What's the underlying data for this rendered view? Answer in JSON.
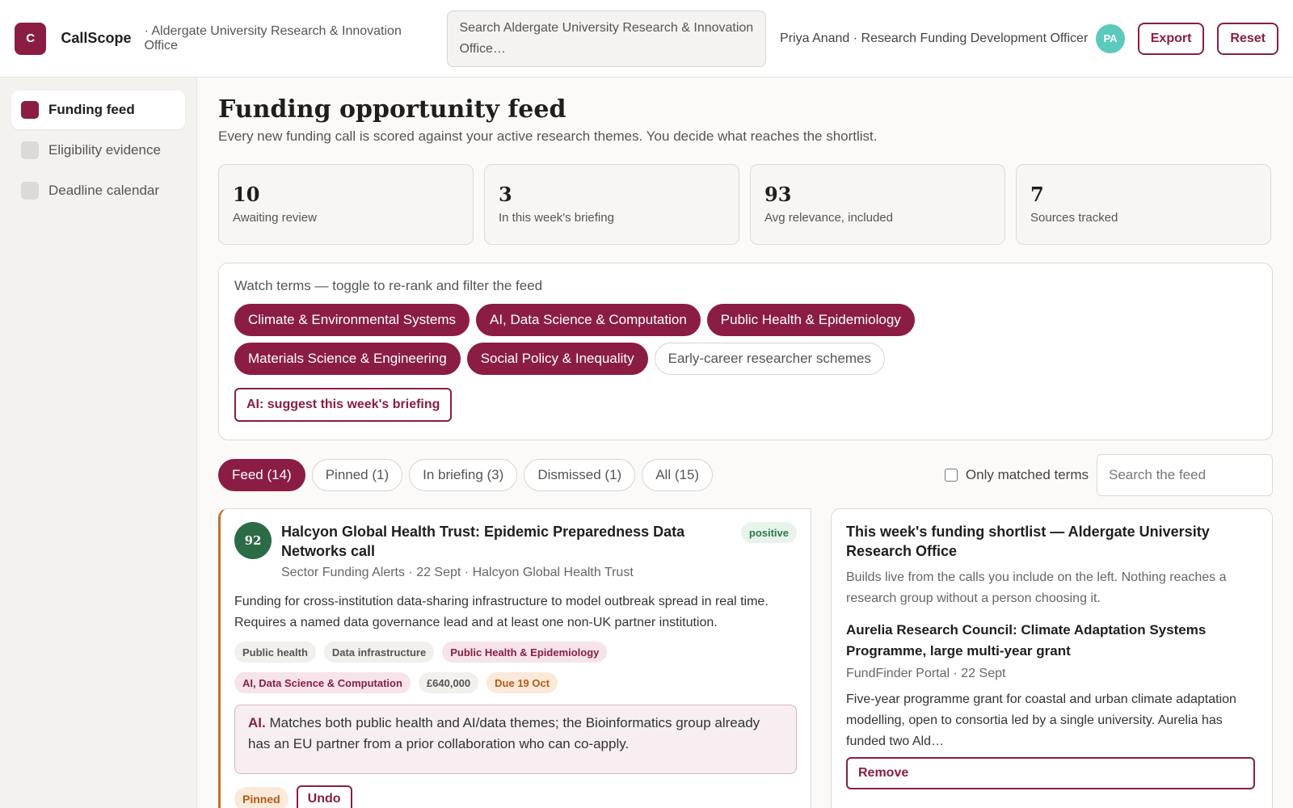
{
  "header": {
    "logo_letter": "C",
    "app_name": "CallScope",
    "org": "· Aldergate University Research & Innovation Office",
    "search_placeholder": "Search Aldergate University Research & Innovation Office…",
    "user": "Priya Anand · Research Funding Development Officer",
    "avatar_initials": "PA",
    "export_label": "Export",
    "reset_label": "Reset"
  },
  "sidebar": {
    "items": [
      {
        "label": "Funding feed",
        "active": true
      },
      {
        "label": "Eligibility evidence",
        "active": false
      },
      {
        "label": "Deadline calendar",
        "active": false
      }
    ]
  },
  "main": {
    "title": "Funding opportunity feed",
    "subtitle": "Every new funding call is scored against your active research themes. You decide what reaches the shortlist.",
    "stats": [
      {
        "value": "10",
        "label": "Awaiting review"
      },
      {
        "value": "3",
        "label": "In this week's briefing"
      },
      {
        "value": "93",
        "label": "Avg relevance, included"
      },
      {
        "value": "7",
        "label": "Sources tracked"
      }
    ],
    "watch": {
      "label": "Watch terms — toggle to re-rank and filter the feed",
      "chips": [
        {
          "label": "Climate & Environmental Systems",
          "on": true
        },
        {
          "label": "AI, Data Science & Computation",
          "on": true
        },
        {
          "label": "Public Health & Epidemiology",
          "on": true
        },
        {
          "label": "Materials Science & Engineering",
          "on": true
        },
        {
          "label": "Social Policy & Inequality",
          "on": true
        },
        {
          "label": "Early-career researcher schemes",
          "on": false
        }
      ],
      "ai_button": "AI: suggest this week's briefing"
    },
    "tabs": [
      {
        "label": "Feed (14)",
        "active": true
      },
      {
        "label": "Pinned (1)",
        "active": false
      },
      {
        "label": "In briefing (3)",
        "active": false
      },
      {
        "label": "Dismissed (1)",
        "active": false
      },
      {
        "label": "All (15)",
        "active": false
      }
    ],
    "only_matched_label": "Only matched terms",
    "search_feed_placeholder": "Search the feed"
  },
  "card": {
    "score": "92",
    "title": "Halcyon Global Health Trust: Epidemic Preparedness Data Networks call",
    "meta": "Sector Funding Alerts · 22 Sept · Halcyon Global Health Trust",
    "sentiment": "positive",
    "description": "Funding for cross-institution data-sharing infrastructure to model outbreak spread in real time. Requires a named data governance lead and at least one non-UK partner institution.",
    "tags": [
      {
        "label": "Public health",
        "kind": "plain"
      },
      {
        "label": "Data infrastructure",
        "kind": "plain"
      },
      {
        "label": "Public Health & Epidemiology",
        "kind": "theme"
      },
      {
        "label": "AI, Data Science & Computation",
        "kind": "theme"
      },
      {
        "label": "£640,000",
        "kind": "plain"
      },
      {
        "label": "Due 19 Oct",
        "kind": "due"
      }
    ],
    "ai_key": "AI.",
    "ai_text": " Matches both public health and AI/data themes; the Bioinformatics group already has an EU partner from a prior collaboration who can co-apply.",
    "pinned_label": "Pinned",
    "undo_label": "Undo"
  },
  "shortlist": {
    "title": "This week's funding shortlist — Aldergate University Research Office",
    "subtitle": "Builds live from the calls you include on the left. Nothing reaches a research group without a person choosing it.",
    "item": {
      "title": "Aurelia Research Council: Climate Adaptation Systems Programme, large multi-year grant",
      "meta": "FundFinder Portal · 22 Sept",
      "description": "Five-year programme grant for coastal and urban climate adaptation modelling, open to consortia led by a single university. Aurelia has funded two Ald…",
      "remove_label": "Remove"
    }
  },
  "colors": {
    "brand": "#8b1d44",
    "avatar": "#5cc9bd",
    "score": "#2b6b45",
    "card_accent": "#c2702b"
  }
}
